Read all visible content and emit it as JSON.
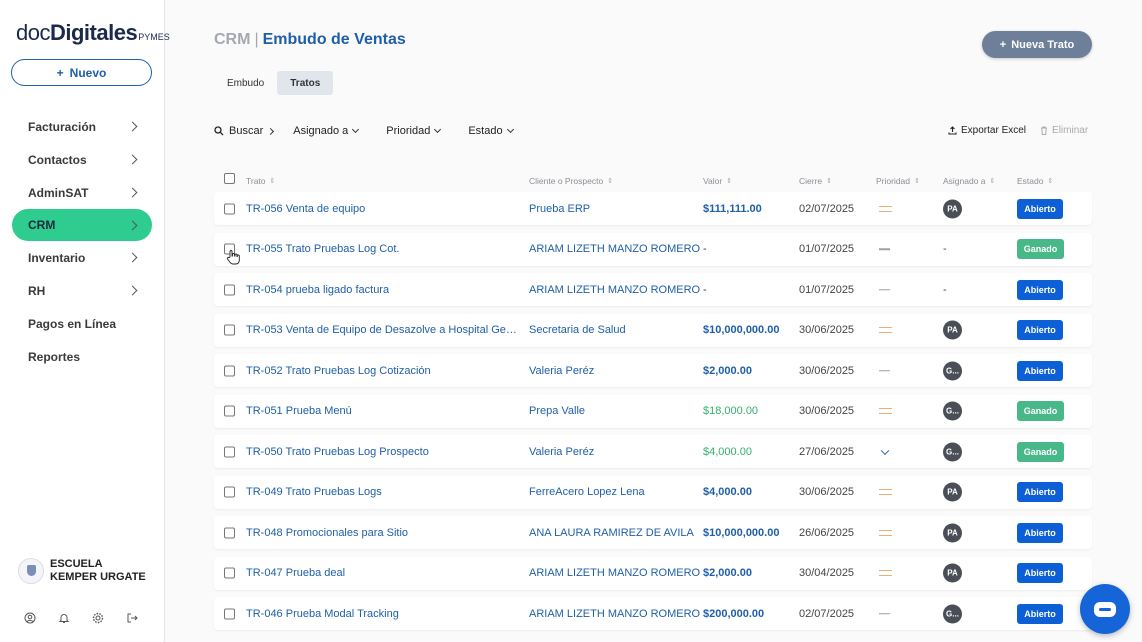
{
  "brand": {
    "part1": "doc",
    "part2": "Digitales",
    "suffix": "PYMES"
  },
  "sidebar": {
    "new_button": "Nuevo",
    "items": [
      {
        "label": "Facturación",
        "chevron": true,
        "active": false
      },
      {
        "label": "Contactos",
        "chevron": true,
        "active": false
      },
      {
        "label": "AdminSAT",
        "chevron": true,
        "active": false
      },
      {
        "label": "CRM",
        "chevron": true,
        "active": true
      },
      {
        "label": "Inventario",
        "chevron": true,
        "active": false
      },
      {
        "label": "RH",
        "chevron": true,
        "active": false
      },
      {
        "label": "Pagos en Línea",
        "chevron": false,
        "active": false
      },
      {
        "label": "Reportes",
        "chevron": false,
        "active": false
      }
    ],
    "organization": "ESCUELA KEMPER URGATE",
    "footer_icons": [
      "user-circle-icon",
      "bell-icon",
      "gear-icon",
      "logout-icon"
    ]
  },
  "header": {
    "section": "CRM",
    "separator": "|",
    "page_title": "Embudo de Ventas",
    "new_deal_button": "Nueva Trato"
  },
  "tabs": [
    {
      "label": "Embudo",
      "active": false
    },
    {
      "label": "Tratos",
      "active": true
    }
  ],
  "toolbar": {
    "search": "Buscar",
    "assigned": "Asignado a",
    "priority": "Prioridad",
    "status": "Estado",
    "export": "Exportar Excel",
    "delete": "Eliminar"
  },
  "table": {
    "columns": [
      "Trato",
      "Cliente o Prospecto",
      "Valor",
      "Cierre",
      "Prioridad",
      "Asignado a",
      "Estado"
    ],
    "rows": [
      {
        "trato": "TR-056 Venta de equipo",
        "cliente": "Prueba ERP",
        "valor": "$111,111.00",
        "valor_style": "blue",
        "cierre": "02/07/2025",
        "prioridad": "medium",
        "asignado": "PA",
        "estado": "Abierto"
      },
      {
        "trato": "TR-055 Trato Pruebas Log Cot.",
        "cliente": "ARIAM LIZETH MANZO ROMERO",
        "valor": "-",
        "valor_style": "dash",
        "cierre": "01/07/2025",
        "prioridad": "none",
        "asignado": "-",
        "estado": "Ganado"
      },
      {
        "trato": "TR-054 prueba ligado factura",
        "cliente": "ARIAM LIZETH MANZO ROMERO",
        "valor": "-",
        "valor_style": "dash",
        "cierre": "01/07/2025",
        "prioridad": "none",
        "asignado": "-",
        "estado": "Abierto"
      },
      {
        "trato": "TR-053 Venta de Equipo de Desazolve a Hospital Gene...",
        "cliente": "Secretaria de Salud",
        "valor": "$10,000,000.00",
        "valor_style": "blue",
        "cierre": "30/06/2025",
        "prioridad": "medium",
        "asignado": "PA",
        "estado": "Abierto"
      },
      {
        "trato": "TR-052 Trato Pruebas Log Cotización",
        "cliente": "Valeria Peréz",
        "valor": "$2,000.00",
        "valor_style": "blue",
        "cierre": "30/06/2025",
        "prioridad": "none",
        "asignado": "G...",
        "estado": "Abierto"
      },
      {
        "trato": "TR-051 Prueba Menú",
        "cliente": "Prepa Valle",
        "valor": "$18,000.00",
        "valor_style": "green",
        "cierre": "30/06/2025",
        "prioridad": "medium",
        "asignado": "G...",
        "estado": "Ganado"
      },
      {
        "trato": "TR-050 Trato Pruebas Log Prospecto",
        "cliente": "Valeria Peréz",
        "valor": "$4,000.00",
        "valor_style": "green",
        "cierre": "27/06/2025",
        "prioridad": "low",
        "asignado": "G...",
        "estado": "Ganado"
      },
      {
        "trato": "TR-049 Trato Pruebas Logs",
        "cliente": "FerreAcero Lopez Lena",
        "valor": "$4,000.00",
        "valor_style": "blue",
        "cierre": "30/06/2025",
        "prioridad": "medium",
        "asignado": "PA",
        "estado": "Abierto"
      },
      {
        "trato": "TR-048 Promocionales para Sitio",
        "cliente": "ANA LAURA RAMIREZ DE AVILA",
        "valor": "$10,000,000.00",
        "valor_style": "blue",
        "cierre": "26/06/2025",
        "prioridad": "medium",
        "asignado": "PA",
        "estado": "Abierto"
      },
      {
        "trato": "TR-047 Prueba deal",
        "cliente": "ARIAM LIZETH MANZO ROMERO",
        "valor": "$2,000.00",
        "valor_style": "blue",
        "cierre": "30/04/2025",
        "prioridad": "medium",
        "asignado": "PA",
        "estado": "Abierto"
      },
      {
        "trato": "TR-046 Prueba Modal Tracking",
        "cliente": "ARIAM LIZETH MANZO ROMERO",
        "valor": "$200,000.00",
        "valor_style": "blue",
        "cierre": "02/07/2025",
        "prioridad": "none",
        "asignado": "G...",
        "estado": "Abierto"
      }
    ]
  },
  "colors": {
    "primary": "#1f5fa8",
    "accent": "#2ecc8f",
    "open": "#0d5fd6",
    "won": "#48b889"
  }
}
